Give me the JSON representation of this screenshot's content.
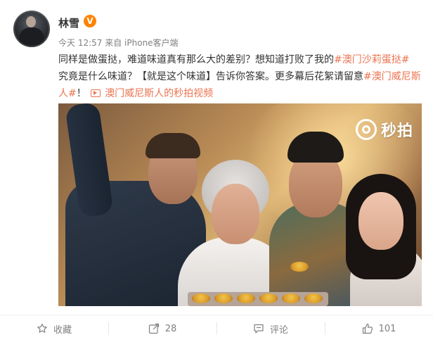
{
  "post": {
    "author": "林雪",
    "verified_badge": "V",
    "time": "今天 12:57",
    "source": "来自 iPhone客户端",
    "text": {
      "part1": "同样是做蛋挞，难道味道真有那么大的差别？想知道打败了我的",
      "topic1": "#澳门沙莉蛋挞#",
      "part2": "究竟是什么味道？【就是这个味道】告诉你答案。更多幕后花絮请留意",
      "topic2": "#澳门威尼斯人#",
      "part3": "！",
      "video_link": "澳门威尼斯人的秒拍视频"
    },
    "media": {
      "watermark": "秒拍",
      "icon": "miaopai-logo-icon"
    }
  },
  "actions": [
    {
      "name": "favorite",
      "icon": "star-icon",
      "label": "收藏"
    },
    {
      "name": "repost",
      "icon": "share-icon",
      "label": "28"
    },
    {
      "name": "comment",
      "icon": "comment-icon",
      "label": "评论"
    },
    {
      "name": "like",
      "icon": "thumbs-up-icon",
      "label": "101"
    }
  ],
  "colors": {
    "link": "#eb7350",
    "badge": "#ff8200",
    "meta_gray": "#808080"
  }
}
